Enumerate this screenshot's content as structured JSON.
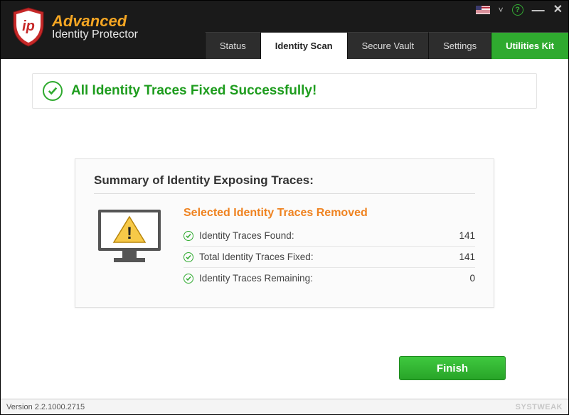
{
  "app": {
    "title_top": "Advanced",
    "title_bottom": "Identity Protector"
  },
  "tabs": {
    "status": {
      "label": "Status"
    },
    "identity": {
      "label": "Identity Scan"
    },
    "vault": {
      "label": "Secure Vault"
    },
    "settings": {
      "label": "Settings"
    },
    "utilities": {
      "label": "Utilities Kit"
    }
  },
  "success_message": "All Identity Traces Fixed Successfully!",
  "summary": {
    "title": "Summary of Identity Exposing Traces:",
    "headline": "Selected Identity Traces Removed",
    "rows": [
      {
        "label": "Identity Traces Found:",
        "value": "141"
      },
      {
        "label": "Total Identity Traces Fixed:",
        "value": "141"
      },
      {
        "label": "Identity Traces Remaining:",
        "value": "0"
      }
    ]
  },
  "buttons": {
    "finish": "Finish"
  },
  "status_bar": {
    "version": "Version 2.2.1000.2715",
    "watermark": "SYSTWEAK"
  },
  "help_glyph": "?"
}
